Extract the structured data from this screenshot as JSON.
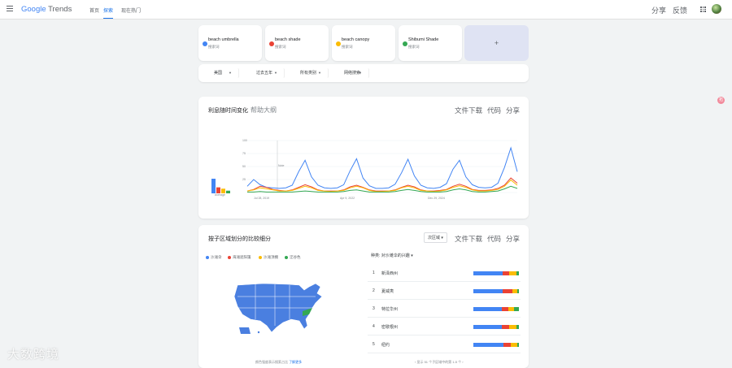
{
  "header": {
    "logo_prefix": "Google",
    "logo_suffix": "Trends",
    "nav": [
      "首页",
      "探索",
      "现在热门"
    ],
    "active_nav": "探索",
    "share_label": "分享",
    "feedback_label": "反馈",
    "apps_icon": "apps-grid-icon",
    "menu_icon": "hamburger-menu-icon"
  },
  "terms": [
    {
      "name": "beach umbrella",
      "type": "搜索词",
      "color": "#4285f4"
    },
    {
      "name": "beach shade",
      "type": "搜索词",
      "color": "#ea4335"
    },
    {
      "name": "beach canopy",
      "type": "搜索词",
      "color": "#fbbc04"
    },
    {
      "name": "Shibumi Shade",
      "type": "搜索词",
      "color": "#34a853"
    }
  ],
  "add_term_label": "+",
  "filters": [
    {
      "label": "美国"
    },
    {
      "label": "过去五年"
    },
    {
      "label": "所有类别"
    },
    {
      "label": "网络搜索"
    }
  ],
  "interest_over_time": {
    "title": "利息随时间变化",
    "subtitle": "帮助大纲",
    "actions": [
      "文件下载",
      "代码",
      "分享"
    ],
    "average_label": "Average",
    "note_label": "Note",
    "x_ticks": [
      "Jul 28, 2019",
      "Apr 9, 2022",
      "Dec 29, 2024"
    ],
    "y_ticks": [
      "100",
      "75",
      "50",
      "25"
    ]
  },
  "chart_data": {
    "type": "line",
    "title": "利息随时间变化",
    "xlabel": "",
    "ylabel": "",
    "ylim": [
      0,
      100
    ],
    "grid": true,
    "averages": [
      {
        "name": "beach umbrella",
        "value": 22
      },
      {
        "name": "beach shade",
        "value": 9
      },
      {
        "name": "beach canopy",
        "value": 7
      },
      {
        "name": "Shibumi Shade",
        "value": 4
      }
    ],
    "series": [
      {
        "name": "beach umbrella",
        "color": "#4285f4",
        "values": [
          12,
          25,
          15,
          10,
          9,
          8,
          9,
          14,
          40,
          62,
          30,
          14,
          9,
          8,
          9,
          15,
          42,
          65,
          28,
          13,
          8,
          8,
          9,
          16,
          38,
          64,
          32,
          14,
          9,
          8,
          10,
          17,
          45,
          62,
          30,
          15,
          10,
          9,
          10,
          18,
          48,
          86,
          40
        ]
      },
      {
        "name": "beach shade",
        "color": "#ea4335",
        "values": [
          3,
          6,
          12,
          10,
          6,
          4,
          3,
          5,
          10,
          15,
          11,
          5,
          3,
          3,
          3,
          5,
          11,
          14,
          10,
          5,
          3,
          3,
          3,
          5,
          10,
          14,
          11,
          5,
          3,
          3,
          4,
          6,
          12,
          16,
          12,
          6,
          4,
          4,
          5,
          8,
          14,
          28,
          18
        ]
      },
      {
        "name": "beach canopy",
        "color": "#fbbc04",
        "values": [
          3,
          5,
          9,
          7,
          5,
          3,
          3,
          4,
          8,
          12,
          9,
          4,
          3,
          2,
          3,
          4,
          9,
          12,
          9,
          4,
          2,
          2,
          3,
          4,
          9,
          12,
          9,
          4,
          3,
          2,
          3,
          5,
          10,
          13,
          10,
          5,
          3,
          3,
          4,
          6,
          12,
          24,
          14
        ]
      },
      {
        "name": "Shibumi Shade",
        "color": "#34a853",
        "values": [
          1,
          1,
          2,
          1,
          1,
          1,
          1,
          1,
          2,
          3,
          2,
          1,
          1,
          1,
          1,
          2,
          4,
          5,
          3,
          1,
          1,
          1,
          1,
          2,
          4,
          6,
          4,
          2,
          1,
          1,
          1,
          2,
          5,
          7,
          5,
          2,
          1,
          1,
          2,
          3,
          7,
          12,
          8
        ]
      }
    ]
  },
  "by_region": {
    "title": "按子区域划分的比较细分",
    "dropdown_label": "次区域",
    "actions": [
      "文件下载",
      "代码",
      "分享"
    ],
    "legend": [
      {
        "label": "沙滩伞",
        "color": "#4285f4"
      },
      {
        "label": "海滩遮阳篷",
        "color": "#ea4335"
      },
      {
        "label": "沙滩顶棚",
        "color": "#fbbc04"
      },
      {
        "label": "涩谷色",
        "color": "#34a853"
      }
    ],
    "sort_label": "种类:",
    "sort_value": "对沙滩伞的兴趣",
    "rows": [
      {
        "rank": "1",
        "name": "新泽西州",
        "shares": [
          0.64,
          0.15,
          0.16,
          0.05
        ]
      },
      {
        "rank": "2",
        "name": "夏威夷",
        "shares": [
          0.64,
          0.22,
          0.1,
          0.04
        ]
      },
      {
        "rank": "3",
        "name": "特拉华州",
        "shares": [
          0.62,
          0.14,
          0.14,
          0.1
        ]
      },
      {
        "rank": "4",
        "name": "密歇根州",
        "shares": [
          0.62,
          0.16,
          0.17,
          0.05
        ]
      },
      {
        "rank": "5",
        "name": "纽约",
        "shares": [
          0.66,
          0.16,
          0.14,
          0.04
        ]
      }
    ],
    "map_note": "颜色强度表示搜索占比",
    "map_note_link": "了解更多",
    "pagination": "显示 51 个子区域中的第 1-5 个",
    "prev_icon": "chevron-left-icon",
    "next_icon": "chevron-right-icon"
  },
  "watermark": "大数跨境",
  "side_badge": "拓"
}
